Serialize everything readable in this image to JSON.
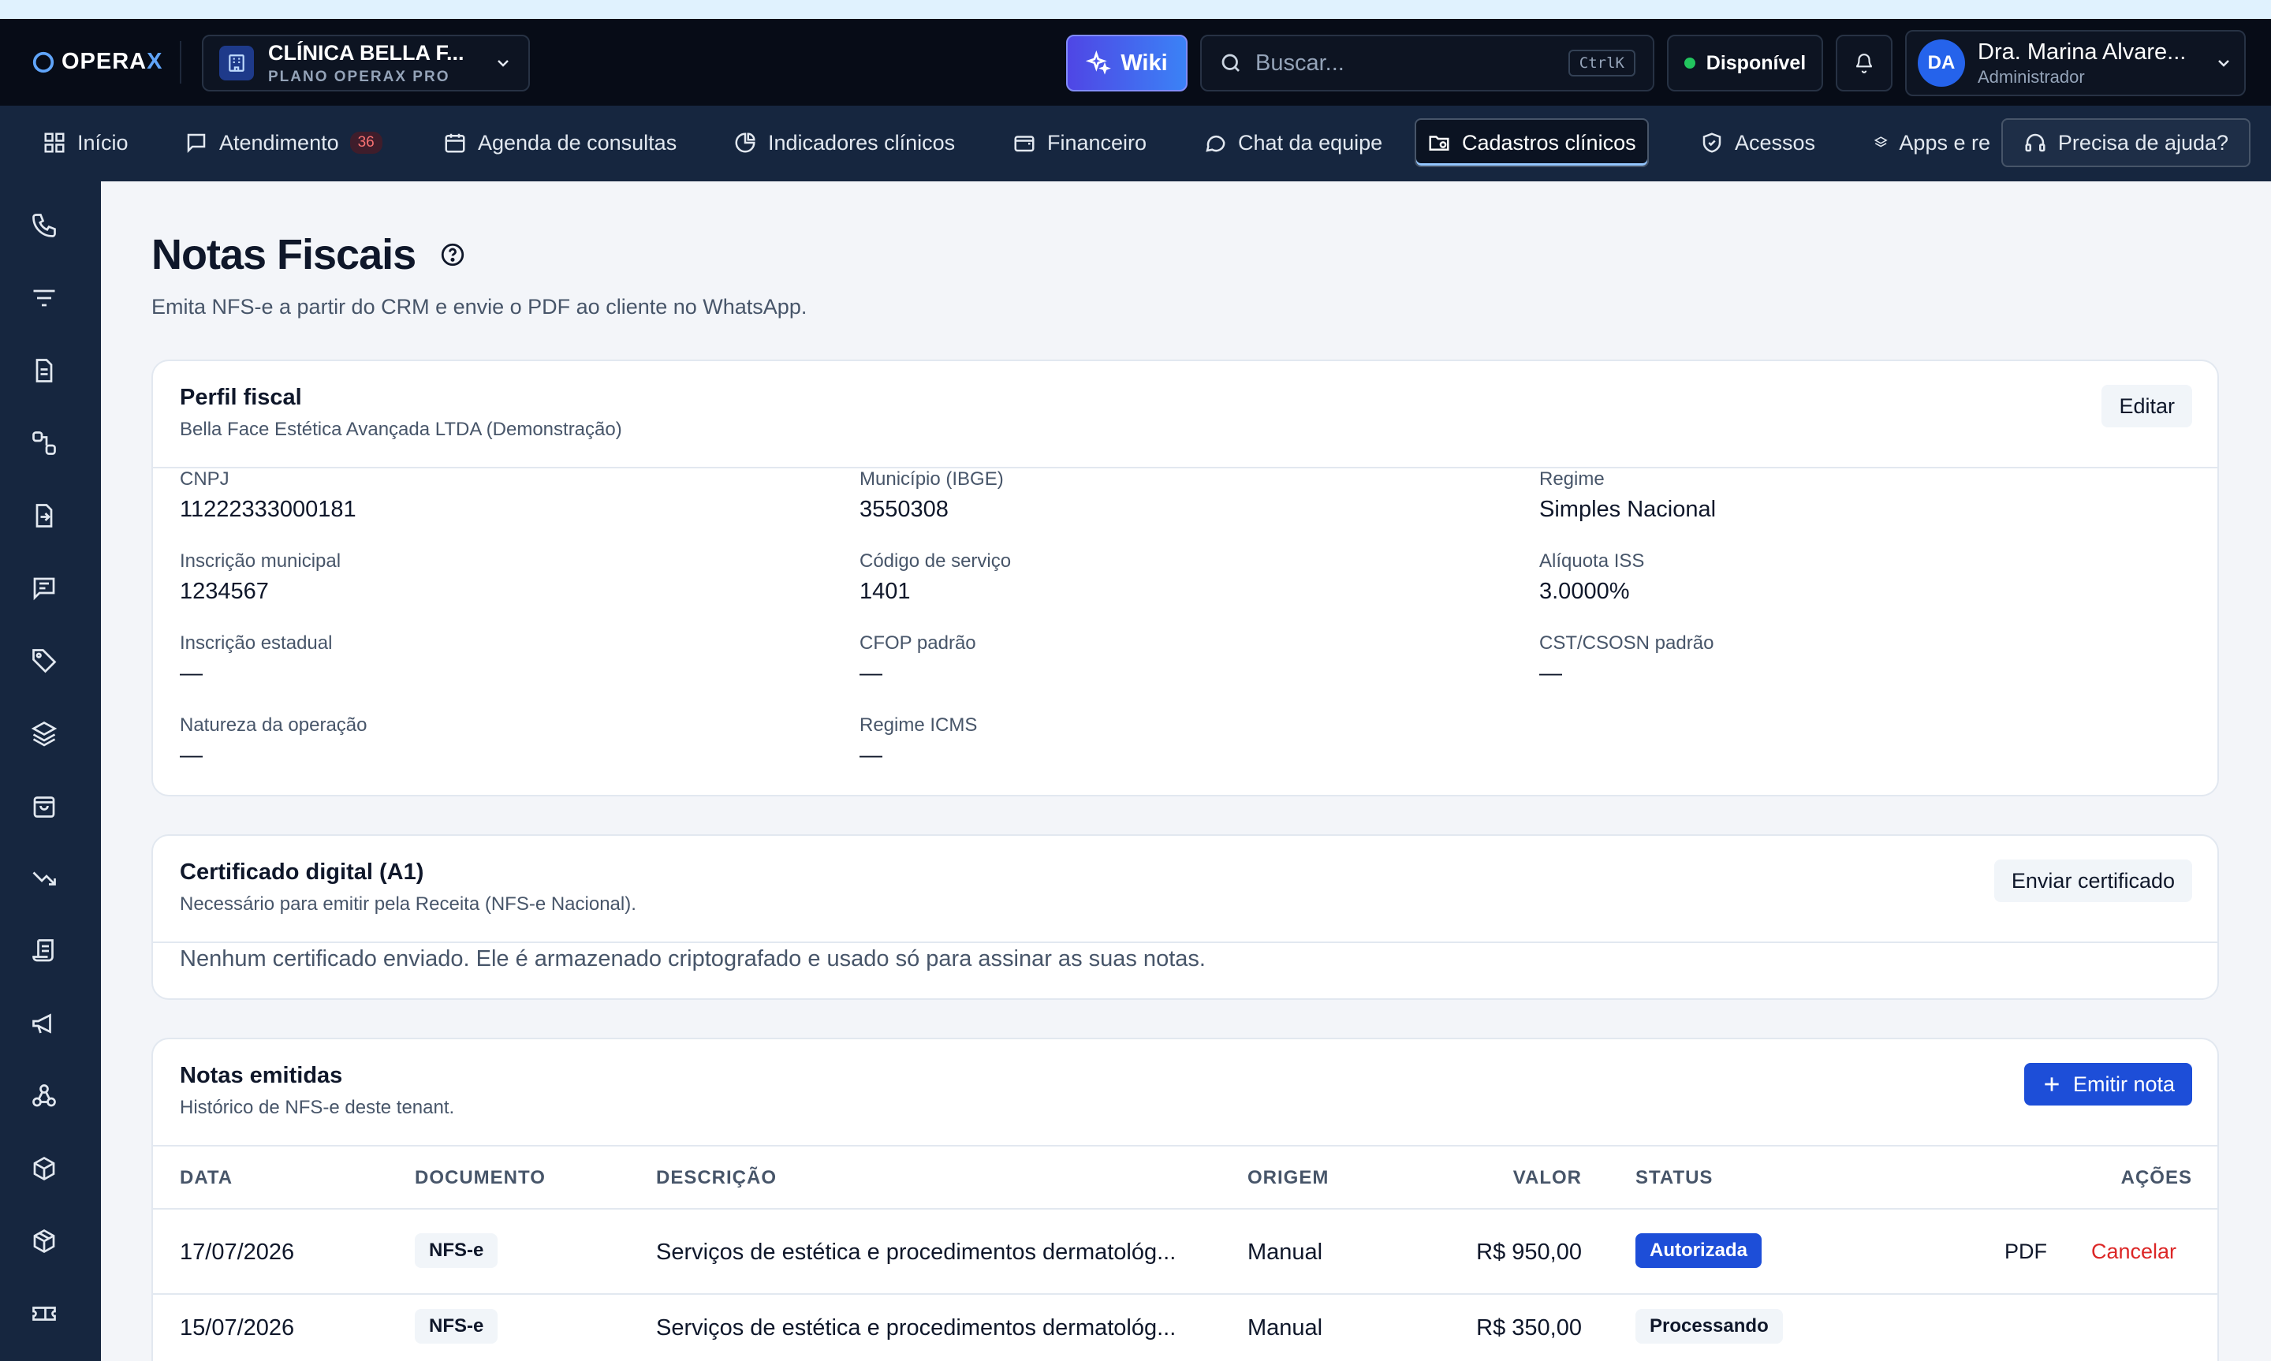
{
  "brand": {
    "logo_main": "OPERA",
    "logo_accent": "X"
  },
  "clinic": {
    "name": "CLÍNICA BELLA F...",
    "plan": "PLANO OPERAX PRO"
  },
  "header": {
    "wiki_label": "Wiki",
    "search_placeholder": "Buscar...",
    "search_shortcut": "CtrlK",
    "status_label": "Disponível",
    "status_color": "#22c55e",
    "user": {
      "initials": "DA",
      "name": "Dra. Marina Alvare...",
      "role": "Administrador"
    }
  },
  "nav": {
    "items": [
      {
        "label": "Início",
        "icon": "grid-icon"
      },
      {
        "label": "Atendimento",
        "icon": "message-icon",
        "badge": "36"
      },
      {
        "label": "Agenda de consultas",
        "icon": "calendar-icon"
      },
      {
        "label": "Indicadores clínicos",
        "icon": "pie-chart-icon"
      },
      {
        "label": "Financeiro",
        "icon": "wallet-icon"
      },
      {
        "label": "Chat da equipe",
        "icon": "chat-icon"
      },
      {
        "label": "Cadastros clínicos",
        "icon": "folder-icon",
        "active": true
      },
      {
        "label": "Acessos",
        "icon": "shield-icon"
      },
      {
        "label": "Apps e re",
        "icon": "layers-icon"
      }
    ],
    "help_label": "Precisa de ajuda?"
  },
  "page": {
    "title": "Notas Fiscais",
    "subtitle": "Emita NFS-e a partir do CRM e envie o PDF ao cliente no WhatsApp."
  },
  "fiscal_profile": {
    "title": "Perfil fiscal",
    "subtitle": "Bella Face Estética Avançada LTDA (Demonstração)",
    "edit_label": "Editar",
    "fields": [
      {
        "label": "CNPJ",
        "value": "11222333000181"
      },
      {
        "label": "Município (IBGE)",
        "value": "3550308"
      },
      {
        "label": "Regime",
        "value": "Simples Nacional"
      },
      {
        "label": "Inscrição municipal",
        "value": "1234567"
      },
      {
        "label": "Código de serviço",
        "value": "1401"
      },
      {
        "label": "Alíquota ISS",
        "value": "3.0000%"
      },
      {
        "label": "Inscrição estadual",
        "value": "—"
      },
      {
        "label": "CFOP padrão",
        "value": "—"
      },
      {
        "label": "CST/CSOSN padrão",
        "value": "—"
      },
      {
        "label": "Natureza da operação",
        "value": "—"
      },
      {
        "label": "Regime ICMS",
        "value": "—"
      }
    ]
  },
  "certificate": {
    "title": "Certificado digital (A1)",
    "subtitle": "Necessário para emitir pela Receita (NFS-e Nacional).",
    "button_label": "Enviar certificado",
    "message": "Nenhum certificado enviado. Ele é armazenado criptografado e usado só para assinar as suas notas."
  },
  "invoices": {
    "title": "Notas emitidas",
    "subtitle": "Histórico de NFS-e deste tenant.",
    "emit_label": "Emitir nota",
    "columns": {
      "date": "DATA",
      "doc": "DOCUMENTO",
      "desc": "DESCRIÇÃO",
      "origin": "ORIGEM",
      "value": "VALOR",
      "status": "STATUS",
      "actions": "AÇÕES"
    },
    "rows": [
      {
        "date": "17/07/2026",
        "doc": "NFS-e",
        "desc": "Serviços de estética e procedimentos dermatológ...",
        "origin": "Manual",
        "value": "R$ 950,00",
        "status": "Autorizada",
        "pdf": "PDF",
        "cancel": "Cancelar"
      },
      {
        "date": "15/07/2026",
        "doc": "NFS-e",
        "desc": "Serviços de estética e procedimentos dermatológ...",
        "origin": "Manual",
        "value": "R$ 350,00",
        "status": "Processando"
      }
    ]
  },
  "colors": {
    "accent": "#1d4ed8",
    "danger": "#dc2626",
    "topbar": "#070c17",
    "navbar": "#16263f"
  }
}
